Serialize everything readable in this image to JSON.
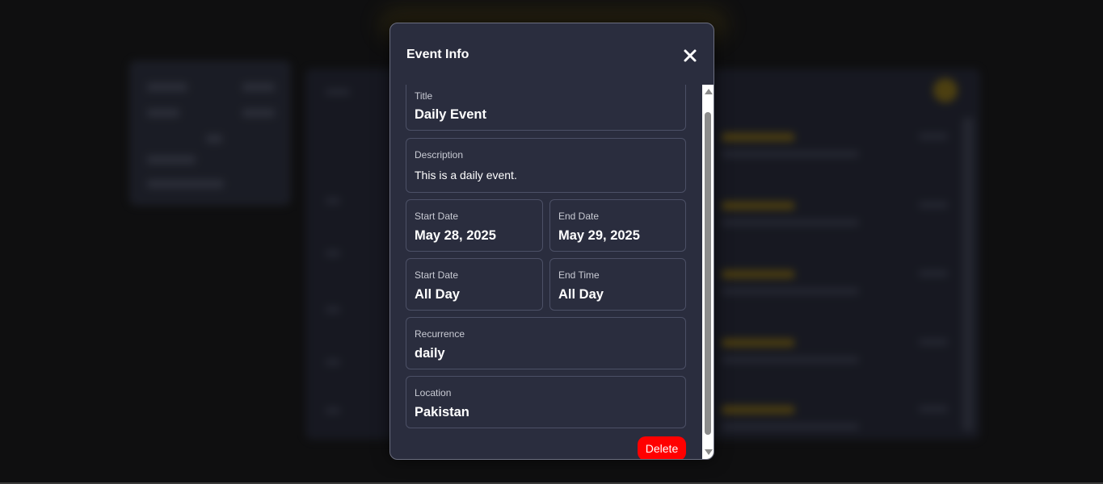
{
  "modal": {
    "title": "Event Info",
    "close_icon": "close-icon",
    "fields": {
      "title": {
        "label": "Title",
        "value": "Daily Event"
      },
      "description": {
        "label": "Description",
        "value": "This is a daily event."
      },
      "start_date": {
        "label": "Start Date",
        "value": "May 28, 2025"
      },
      "end_date": {
        "label": "End Date",
        "value": "May 29, 2025"
      },
      "start_time": {
        "label": "Start Date",
        "value": "All Day"
      },
      "end_time": {
        "label": "End Time",
        "value": "All Day"
      },
      "recurrence": {
        "label": "Recurrence",
        "value": "daily"
      },
      "location": {
        "label": "Location",
        "value": "Pakistan"
      }
    },
    "delete_label": "Delete"
  },
  "colors": {
    "modal_bg": "#2a2d3e",
    "delete": "#ff0000",
    "page_bg": "#0f0f10",
    "accent": "#8a7012"
  }
}
